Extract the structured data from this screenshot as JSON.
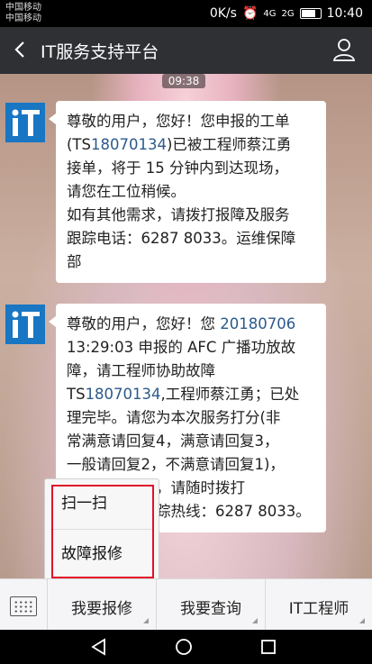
{
  "status_bar": {
    "carrier_1": "中国移动",
    "carrier_2": "中国移动",
    "speed": "0K/s",
    "signal_1": "4G",
    "signal_2": "2G",
    "time": "10:40"
  },
  "header": {
    "title": "IT服务支持平台"
  },
  "chat": {
    "timestamp": "09:38",
    "messages": [
      {
        "lines": [
          [
            {
              "t": "尊敬的用户，您好！您申报的工单"
            }
          ],
          [
            {
              "t": "(TS"
            },
            {
              "t": "18070134",
              "hl": true
            },
            {
              "t": ")已被工程师蔡江勇"
            }
          ],
          [
            {
              "t": "接单，将于 15 分钟内到达现场，"
            }
          ],
          [
            {
              "t": "请您在工位稍候。"
            }
          ],
          [
            {
              "t": "如有其他需求，请拨打报障及服务"
            }
          ],
          [
            {
              "t": "跟踪电话：6287 8033。运维保障"
            }
          ],
          [
            {
              "t": "部"
            }
          ]
        ]
      },
      {
        "lines": [
          [
            {
              "t": "尊敬的用户，您好！您 "
            },
            {
              "t": "20180706",
              "hl": true
            }
          ],
          [
            {
              "t": "13:29:03 申报的 AFC 广播功放故"
            }
          ],
          [
            {
              "t": "障，请工程师协助故障"
            }
          ],
          [
            {
              "t": "TS"
            },
            {
              "t": "18070134",
              "hl": true
            },
            {
              "t": ",工程师蔡江勇；已处"
            }
          ],
          [
            {
              "t": "理完毕。请您为本次服务打分(非"
            }
          ],
          [
            {
              "t": "常满意请回复4，满意请回复3，"
            }
          ],
          [
            {
              "t": "一般请回复2，不满意请回复1)，"
            }
          ],
          [
            {
              "t": "如有其他需求，请随时拨打"
            }
          ],
          [
            {
              "t": "报障及服务跟踪热线：6287 8033。"
            }
          ]
        ]
      }
    ]
  },
  "popup": {
    "items": [
      "扫一扫",
      "故障报修"
    ]
  },
  "menu": {
    "tabs": [
      "我要报修",
      "我要查询",
      "IT工程师"
    ]
  },
  "colors": {
    "nav_bar": "#2f3034",
    "highlight_border": "#e1112a",
    "link": "#2c5a8c"
  },
  "icons": [
    "back-arrow-icon",
    "user-icon",
    "it-logo-icon",
    "keyboard-icon",
    "back-triangle-icon",
    "home-circle-icon",
    "recents-square-icon"
  ]
}
